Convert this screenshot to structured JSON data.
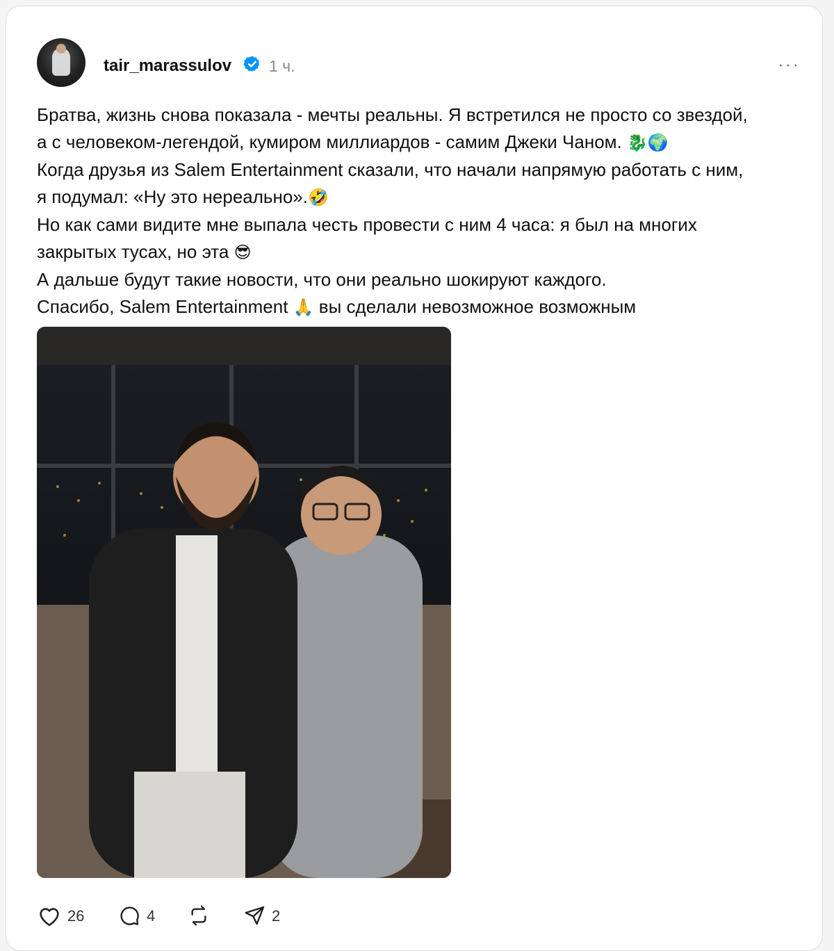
{
  "post": {
    "username": "tair_marassulov",
    "time": "1 ч.",
    "more_label": "···",
    "text_lines": [
      "Братва, жизнь снова показала - мечты реальны. Я встретился не просто со звездой,",
      "а с человеком-легендой, кумиром миллиардов - самим Джеки Чаном.",
      "Когда друзья из Salem Entertainment сказали, что начали напрямую работать с ним,",
      "я подумал: «Ну это нереально».",
      "Но как сами видите мне выпала честь провести с ним 4 часа: я был на многих",
      "закрытых тусах, но эта",
      "А дальше будут такие новости, что они реально шокируют каждого.",
      "Спасибо, Salem Entertainment",
      "вы сделали невозможное возможным"
    ],
    "emojis": {
      "dragon": "🐉",
      "globe": "🌍",
      "laugh": "🤣",
      "cool": "😎",
      "pray": "🙏"
    },
    "likes": "26",
    "comments": "4",
    "shares": "2"
  },
  "icons": {
    "verified": "verified-badge-icon",
    "like": "heart-icon",
    "comment": "comment-icon",
    "repost": "repost-icon",
    "share": "send-icon"
  },
  "colors": {
    "verified_blue": "#0095f6",
    "text": "#101010",
    "muted": "#8a8a8a"
  }
}
